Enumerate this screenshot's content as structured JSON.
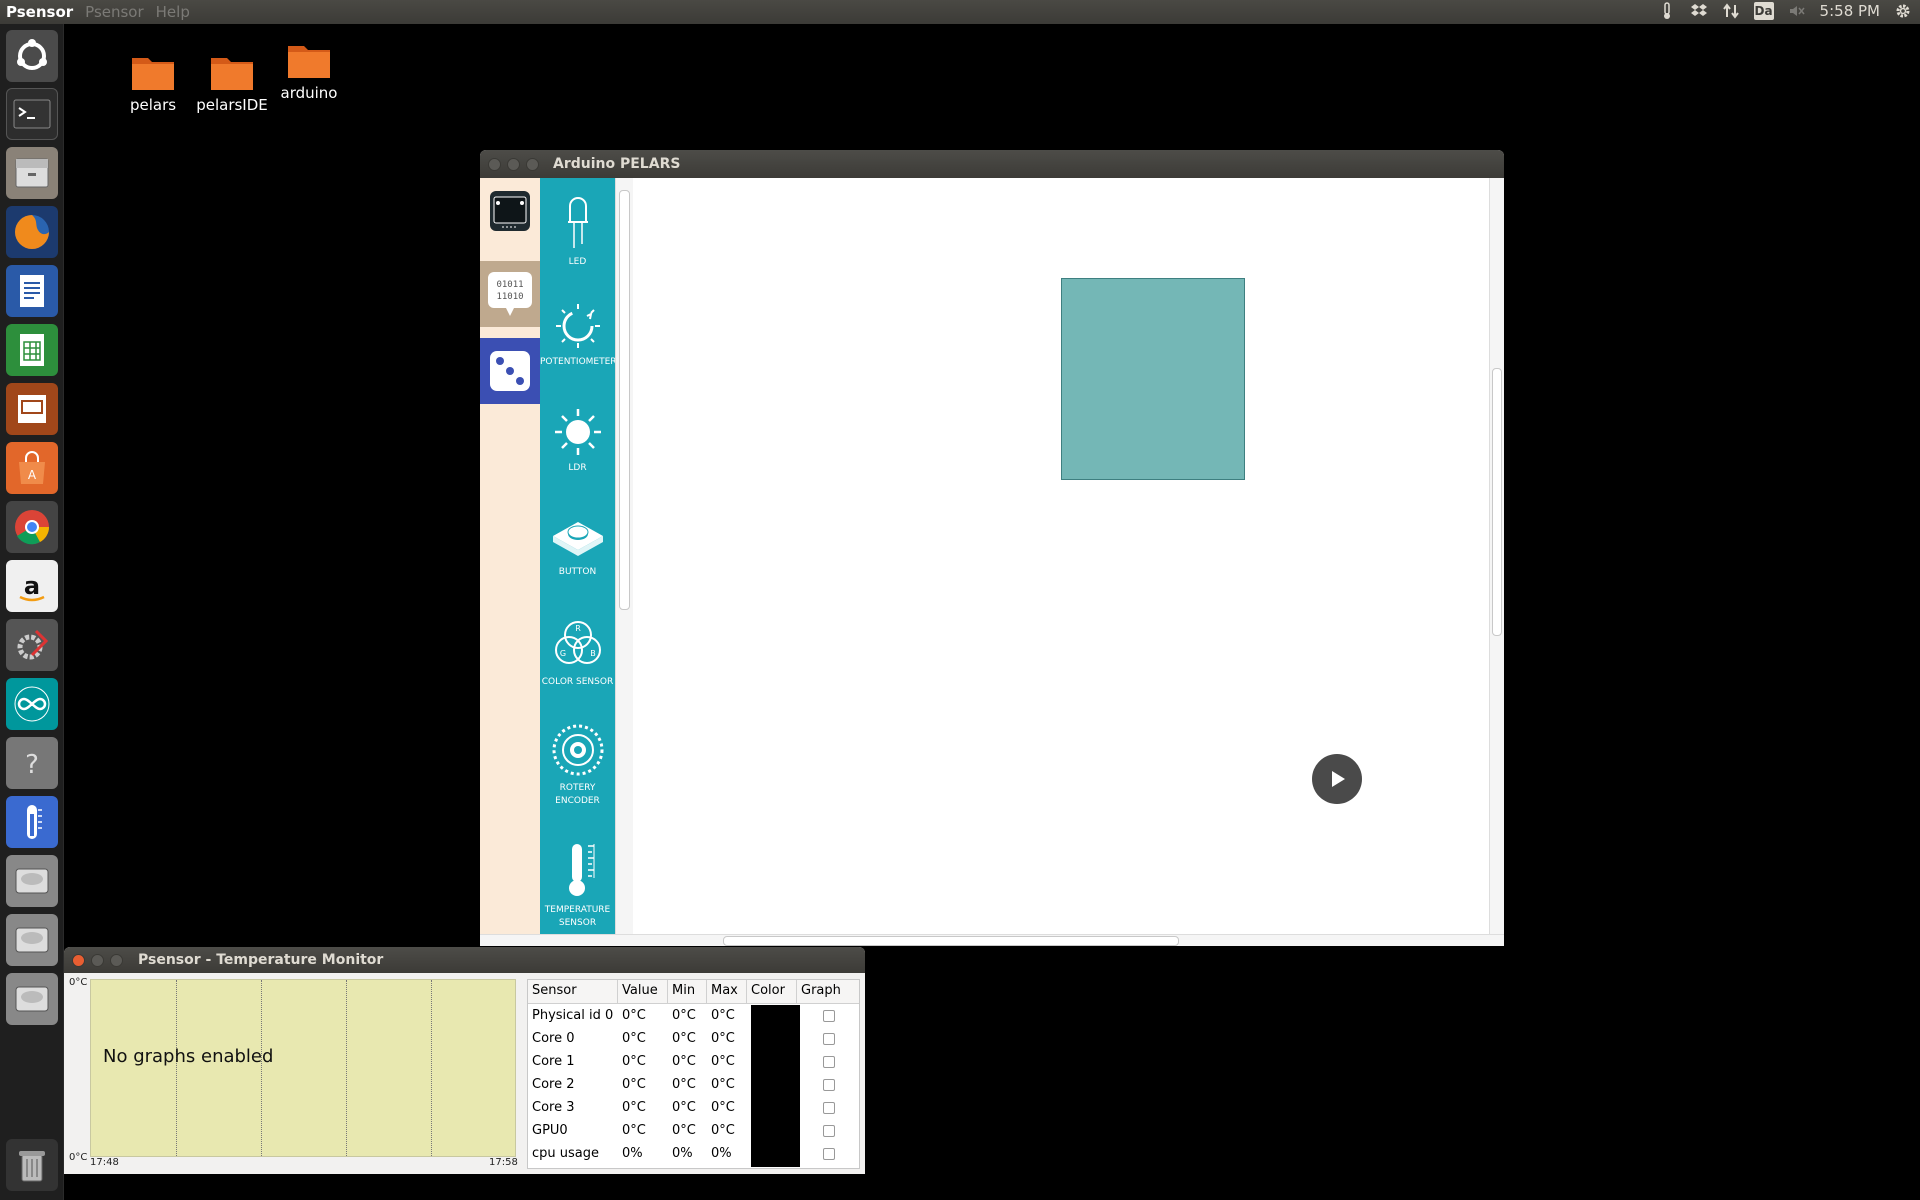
{
  "topbar": {
    "app_name": "Psensor",
    "menus": [
      "Psensor",
      "Help"
    ],
    "tray_keyboard": "Da",
    "clock": "5:58 PM",
    "icons": [
      "thermometer-icon",
      "dropbox-icon",
      "network-arrows-icon",
      "keyboard-layout-icon",
      "mute-icon",
      "gear-icon"
    ]
  },
  "launcher": {
    "items": [
      "ubuntu-dash",
      "terminal",
      "file-manager",
      "firefox",
      "writer",
      "calc",
      "impress",
      "software-center",
      "chrome",
      "amazon",
      "system-settings",
      "arduino",
      "help",
      "psensor",
      "drive",
      "drive",
      "drive",
      "trash"
    ]
  },
  "desktop": {
    "icons": [
      {
        "label": "pelars"
      },
      {
        "label": "pelarsIDE"
      },
      {
        "label": "arduino"
      }
    ]
  },
  "arduino_window": {
    "title": "Arduino PELARS",
    "components": [
      {
        "label": "LED"
      },
      {
        "label": "POTENTIOMETER"
      },
      {
        "label": "LDR"
      },
      {
        "label": "BUTTON"
      },
      {
        "label": "COLOR SENSOR"
      },
      {
        "label": "ROTERY ENCODER"
      },
      {
        "label": "TEMPERATURE SENSOR"
      }
    ],
    "block_color": "#74b7b6",
    "accent": "#1aa6b7",
    "color_sensor_letters": {
      "r": "R",
      "g": "G",
      "b": "B"
    },
    "binary_text": [
      "01011",
      "11010"
    ]
  },
  "psensor_window": {
    "title": "Psensor - Temperature Monitor",
    "graph": {
      "message": "No graphs enabled",
      "y_top": "0°C",
      "y_bottom": "0°C",
      "x_start": "17:48",
      "x_end": "17:58"
    },
    "table": {
      "headers": [
        "Sensor",
        "Value",
        "Min",
        "Max",
        "Color",
        "Graph"
      ],
      "rows": [
        {
          "sensor": "Physical id 0",
          "value": "0°C",
          "min": "0°C",
          "max": "0°C"
        },
        {
          "sensor": "Core 0",
          "value": "0°C",
          "min": "0°C",
          "max": "0°C"
        },
        {
          "sensor": "Core 1",
          "value": "0°C",
          "min": "0°C",
          "max": "0°C"
        },
        {
          "sensor": "Core 2",
          "value": "0°C",
          "min": "0°C",
          "max": "0°C"
        },
        {
          "sensor": "Core 3",
          "value": "0°C",
          "min": "0°C",
          "max": "0°C"
        },
        {
          "sensor": "GPU0",
          "value": "0°C",
          "min": "0°C",
          "max": "0°C"
        },
        {
          "sensor": "cpu usage",
          "value": "0%",
          "min": "0%",
          "max": "0%"
        }
      ]
    }
  }
}
